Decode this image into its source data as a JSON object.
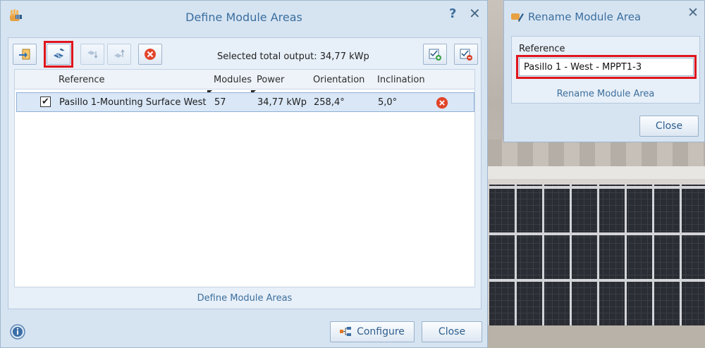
{
  "main_dialog": {
    "title": "Define Module Areas",
    "help_glyph": "?",
    "close_glyph": "✕",
    "toolbar": {
      "buttons": [
        {
          "name": "import-icon",
          "enabled": true
        },
        {
          "name": "satellite-icon",
          "enabled": true,
          "highlighted": true
        },
        {
          "name": "move-down-icon",
          "enabled": false
        },
        {
          "name": "move-up-icon",
          "enabled": false
        },
        {
          "name": "delete-icon",
          "enabled": true
        },
        {
          "name": "select-all-icon",
          "enabled": true
        },
        {
          "name": "deselect-all-icon",
          "enabled": true
        }
      ],
      "selected_output_label": "Selected total output:",
      "selected_output_value": "34,77 kWp"
    },
    "table": {
      "columns": [
        "Reference",
        "Modules",
        "Power",
        "Orientation",
        "Inclination"
      ],
      "rows": [
        {
          "checked": true,
          "reference": "Pasillo 1-Mounting Surface West",
          "modules": "57",
          "power": "34,77 kWp",
          "orientation": "258,4°",
          "inclination": "5,0°"
        }
      ]
    },
    "section_label": "Define Module Areas",
    "buttons": {
      "configure": "Configure",
      "close": "Close"
    }
  },
  "rename_dialog": {
    "title": "Rename Module Area",
    "close_glyph": "✕",
    "field_label": "Reference",
    "field_value": "Pasillo 1 - West - MPPT1-3",
    "section_label": "Rename Module Area",
    "close_button": "Close"
  },
  "colors": {
    "accent": "#3b6e9e",
    "highlight_box": "#e0141c",
    "dialog_bg": "#d6e4f2",
    "row_selected": "#d9e7f7"
  }
}
